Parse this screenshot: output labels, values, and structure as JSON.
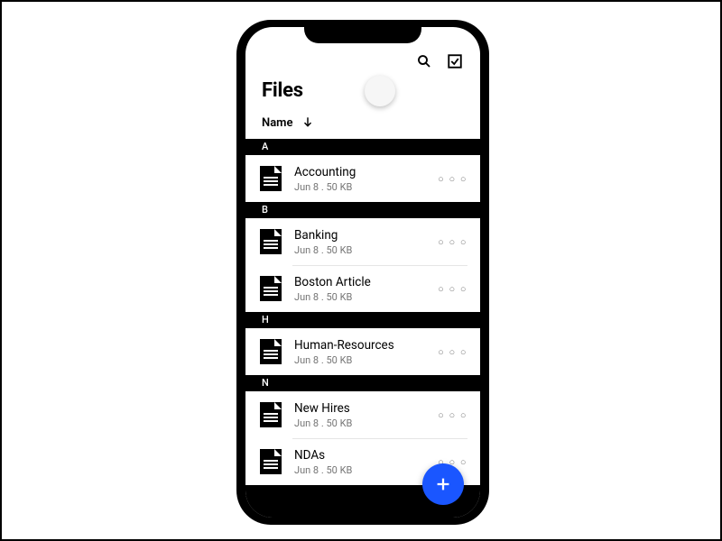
{
  "page_title": "Files",
  "sort": {
    "label": "Name",
    "direction": "desc"
  },
  "more_glyph": "○ ○ ○",
  "fab_color": "#1a56ff",
  "icons": {
    "search": "search-icon",
    "select": "checkbox-select-icon",
    "sort_arrow": "arrow-down-icon",
    "fab": "plus-icon"
  },
  "sections": [
    {
      "letter": "A",
      "items": [
        {
          "name": "Accounting",
          "meta": "Jun 8 . 50 KB"
        }
      ]
    },
    {
      "letter": "B",
      "items": [
        {
          "name": "Banking",
          "meta": "Jun 8 . 50 KB"
        },
        {
          "name": "Boston Article",
          "meta": "Jun 8 . 50 KB"
        }
      ]
    },
    {
      "letter": "H",
      "items": [
        {
          "name": "Human-Resources",
          "meta": "Jun 8 . 50 KB"
        }
      ]
    },
    {
      "letter": "N",
      "items": [
        {
          "name": "New Hires",
          "meta": "Jun 8 . 50 KB"
        },
        {
          "name": "NDAs",
          "meta": "Jun 8 . 50 KB"
        }
      ]
    }
  ]
}
